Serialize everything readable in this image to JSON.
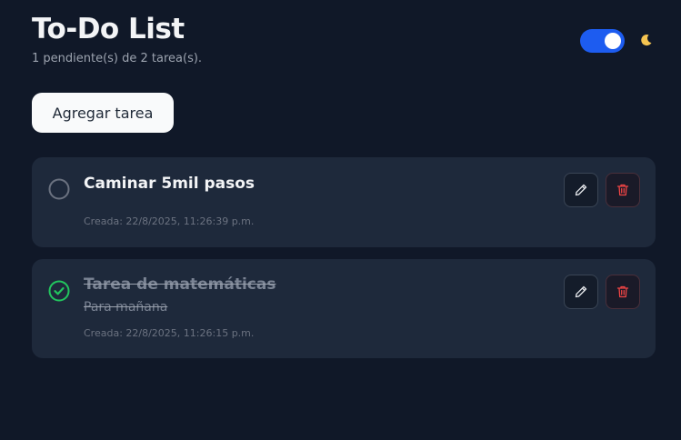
{
  "header": {
    "title": "To-Do List",
    "subtitle": "1 pendiente(s) de 2 tarea(s)."
  },
  "theme_toggle": {
    "state": "on",
    "accent": "#1d5cf0",
    "icon": "moon-icon"
  },
  "toolbar": {
    "add_label": "Agregar tarea"
  },
  "tasks": [
    {
      "title": "Caminar 5mil pasos",
      "description": "",
      "created": "Creada: 22/8/2025, 11:26:39 p.m.",
      "completed": false
    },
    {
      "title": "Tarea de matemáticas",
      "description": "Para mañana",
      "created": "Creada: 22/8/2025, 11:26:15 p.m.",
      "completed": true
    }
  ],
  "colors": {
    "background": "#101828",
    "card": "#1e293b",
    "complete_check": "#22c55e",
    "delete_icon": "#ef4444"
  }
}
